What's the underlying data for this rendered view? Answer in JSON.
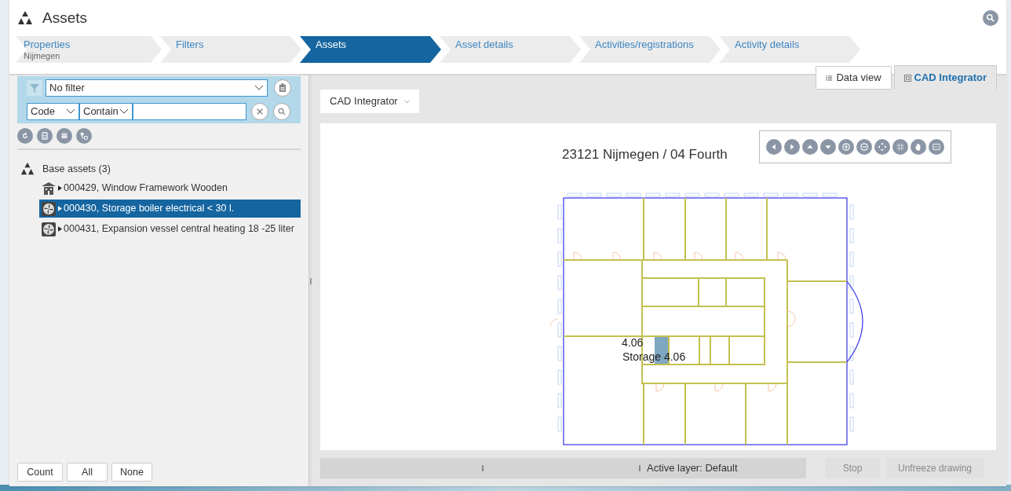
{
  "header": {
    "title": "Assets"
  },
  "steps": [
    {
      "label": "Properties",
      "subtitle": "Nijmegen",
      "selected": false
    },
    {
      "label": "Filters",
      "selected": false
    },
    {
      "label": "Assets",
      "selected": true
    },
    {
      "label": "Asset details",
      "selected": false
    },
    {
      "label": "Activities/registrations",
      "selected": false
    },
    {
      "label": "Activity details",
      "selected": false
    }
  ],
  "filter": {
    "value": "No filter",
    "field": "Code",
    "operator": "Contain"
  },
  "tree": {
    "label": "Base assets (3)",
    "children": [
      {
        "label": "000429, Window Framework Wooden",
        "kind": "building",
        "selected": false
      },
      {
        "label": "000430, Storage boiler electrical < 30 l.",
        "kind": "fan",
        "selected": true
      },
      {
        "label": "000431, Expansion vessel central heating 18 -25 liter",
        "kind": "fan",
        "selected": false
      }
    ]
  },
  "left_buttons": [
    "Count",
    "All",
    "None"
  ],
  "view_tabs": [
    {
      "label": "Data view",
      "selected": false
    },
    {
      "label": "CAD Integrator",
      "selected": true
    }
  ],
  "module_dropdown": "CAD Integrator",
  "drawing": {
    "title": "23121 Nijmegen / 04 Fourth",
    "room_number": "4.06",
    "room_label": "Storage 4.06"
  },
  "status_bar": {
    "layer": "Active layer: Default",
    "buttons": [
      {
        "label": "Stop",
        "disabled": true
      },
      {
        "label": "Unfreeze drawing",
        "disabled": true
      }
    ]
  }
}
